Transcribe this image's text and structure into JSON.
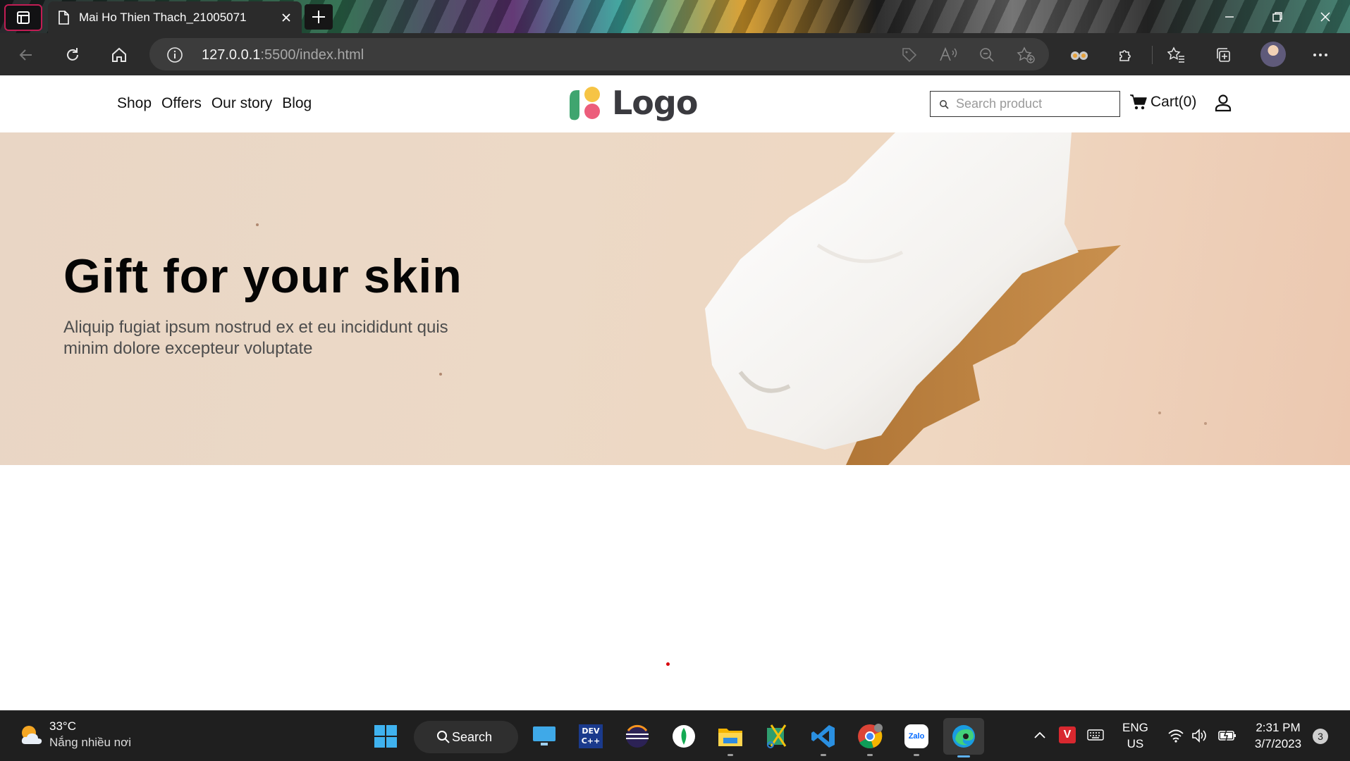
{
  "browser": {
    "tab_title": "Mai Ho Thien Thach_21005071",
    "url_host": "127.0.0.1",
    "url_rest": ":5500/index.html"
  },
  "site": {
    "nav": [
      "Shop",
      "Offers",
      "Our story",
      "Blog"
    ],
    "logo_text": "Logo",
    "logo_colors": {
      "green": "#3fa56f",
      "yellow": "#f6c445",
      "pink": "#ec5d7b"
    },
    "search_placeholder": "Search product",
    "cart_label": "Cart(0)"
  },
  "hero": {
    "title": "Gift for your skin",
    "subtitle": "Aliquip fugiat ipsum nostrud ex et eu incididunt quis minim dolore excepteur voluptate"
  },
  "taskbar": {
    "weather_temp": "33°C",
    "weather_desc": "Nắng nhiều nơi",
    "search_label": "Search",
    "lang_line1": "ENG",
    "lang_line2": "US",
    "time": "2:31 PM",
    "date": "3/7/2023",
    "notification_count": "3",
    "apps": [
      "widgets-icon",
      "search",
      "desktop-icon",
      "devc-icon",
      "eclipse-icon",
      "mongodb-icon",
      "file-explorer-icon",
      "snipping-icon",
      "vscode-icon",
      "chrome-icon",
      "zalo-icon",
      "edge-icon"
    ]
  }
}
